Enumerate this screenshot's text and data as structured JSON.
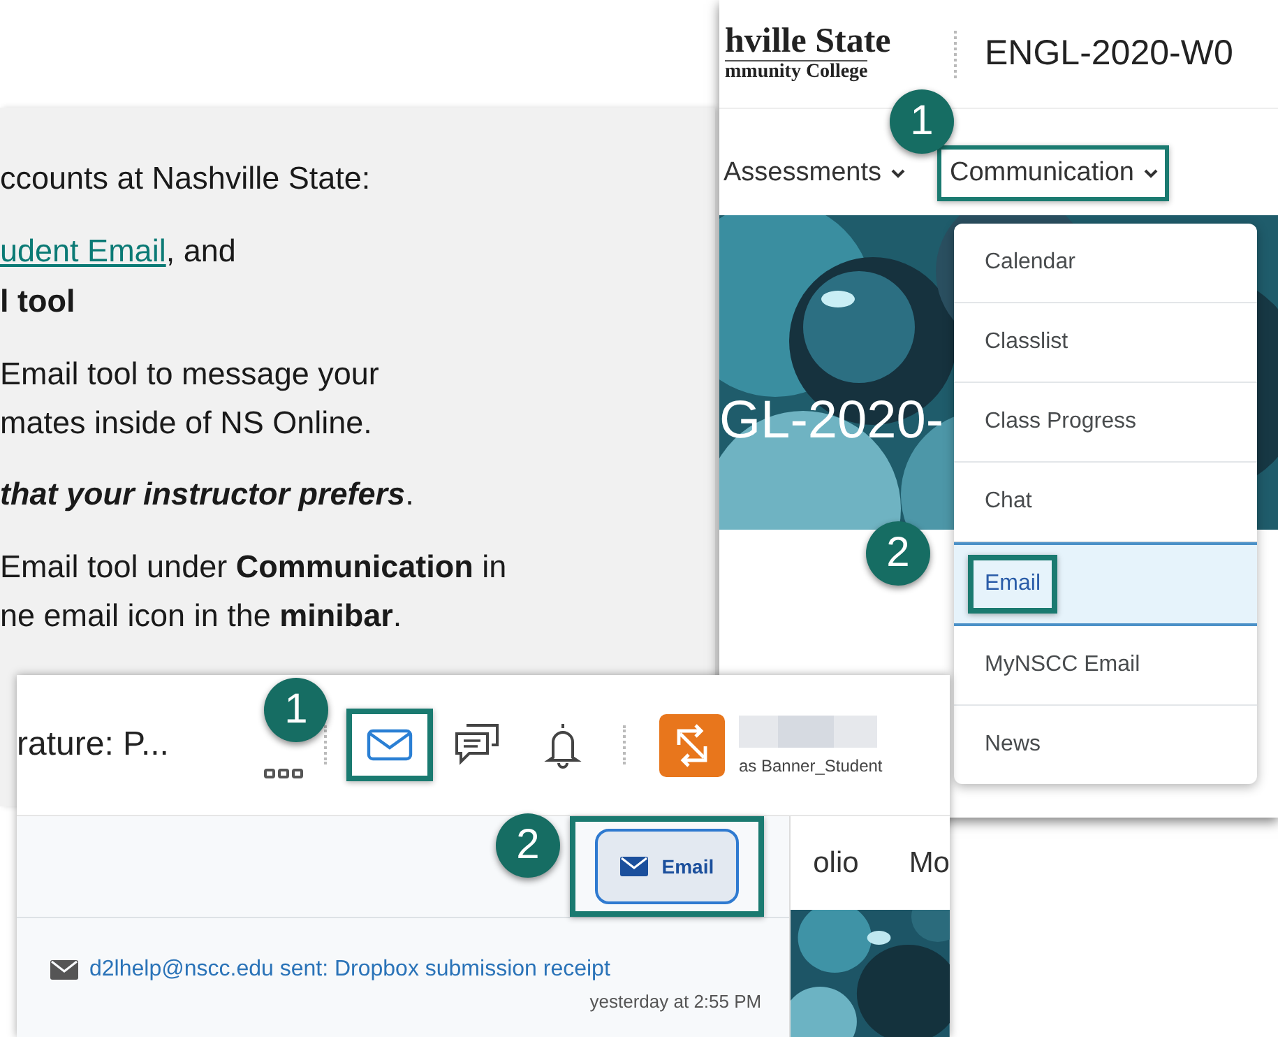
{
  "instructions": {
    "paragraphs": [
      {
        "lines": [
          {
            "kind": "text",
            "text": "ccounts at Nashville State:"
          }
        ]
      },
      {
        "lines": [
          {
            "kind": "link",
            "link": "udent Email",
            "text": ", and"
          },
          {
            "kind": "strong",
            "text": "l tool"
          }
        ]
      },
      {
        "lines": [
          {
            "kind": "text",
            "text": "Email tool to message your"
          },
          {
            "kind": "text",
            "text": "mates inside of NS Online."
          }
        ]
      },
      {
        "lines": [
          {
            "kind": "emphasis",
            "emphasis": "that your instructor prefers",
            "text": "."
          }
        ]
      },
      {
        "lines": [
          {
            "kind": "text",
            "text": "Email tool under **Communication** in"
          },
          {
            "kind": "text",
            "text": "ne email icon in the **minibar**."
          }
        ]
      }
    ]
  },
  "course_window": {
    "logo_lines": [
      "hville State",
      "mmunity College"
    ],
    "course_title": "ENGL-2020-W0",
    "nav": [
      {
        "label": "Assessments",
        "highlighted": false
      },
      {
        "label": "Communication",
        "highlighted": true
      }
    ],
    "banner_title": "GL-2020-",
    "menu": [
      {
        "label": "Calendar",
        "selected": false
      },
      {
        "label": "Classlist",
        "selected": false
      },
      {
        "label": "Class Progress",
        "selected": false
      },
      {
        "label": "Chat",
        "selected": false
      },
      {
        "label": "Email",
        "selected": true
      },
      {
        "label": "MyNSCC Email",
        "selected": false
      },
      {
        "label": "News",
        "selected": false
      }
    ],
    "callouts": [
      "1",
      "2"
    ]
  },
  "minibar_window": {
    "title": "rature: P...",
    "minibar": [
      {
        "kind": "grid",
        "highlighted": false
      },
      {
        "kind": "mail",
        "highlighted": true
      },
      {
        "kind": "chat",
        "highlighted": false
      },
      {
        "kind": "bell",
        "highlighted": false
      }
    ],
    "user_role": "as Banner_Student",
    "popup": {
      "button": {
        "label": "Email",
        "highlighted": true
      },
      "notifications": [
        {
          "text": "d2lhelp@nscc.edu sent: Dropbox submission receipt",
          "time": "yesterday at 2:55 PM"
        }
      ]
    },
    "nav_fragments": [
      "olio",
      "Mo"
    ],
    "callouts": [
      "1",
      "2"
    ]
  }
}
